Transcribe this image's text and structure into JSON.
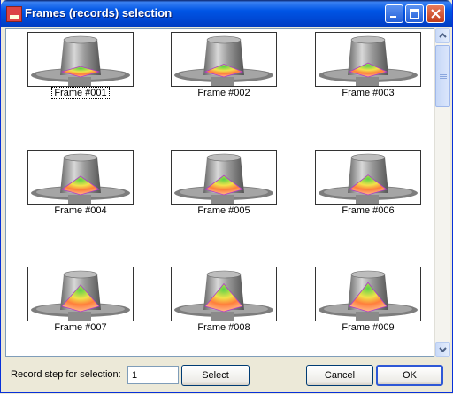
{
  "window": {
    "title": "Frames (records) selection",
    "controls": [
      "minimize-icon",
      "maximize-icon",
      "close-icon"
    ]
  },
  "frames": [
    {
      "label": "Frame #001",
      "spot_level": 0.0,
      "selected": true
    },
    {
      "label": "Frame #002",
      "spot_level": 0.1,
      "selected": false
    },
    {
      "label": "Frame #003",
      "spot_level": 0.15,
      "selected": false
    },
    {
      "label": "Frame #004",
      "spot_level": 0.35,
      "selected": false
    },
    {
      "label": "Frame #005",
      "spot_level": 0.38,
      "selected": false
    },
    {
      "label": "Frame #006",
      "spot_level": 0.4,
      "selected": false
    },
    {
      "label": "Frame #007",
      "spot_level": 0.7,
      "selected": false
    },
    {
      "label": "Frame #008",
      "spot_level": 0.75,
      "selected": false
    },
    {
      "label": "Frame #009",
      "spot_level": 0.8,
      "selected": false
    }
  ],
  "bottom": {
    "step_label": "Record step for selection:",
    "step_value": "1",
    "select_label": "Select",
    "cancel_label": "Cancel",
    "ok_label": "OK"
  },
  "colors": {
    "title_bar": "#0055E5",
    "cup_body": "#9a9a9a",
    "hot_spot": "#ff7e3c",
    "cool_spot": "#5ad24a",
    "contour": "#b03cc8"
  }
}
